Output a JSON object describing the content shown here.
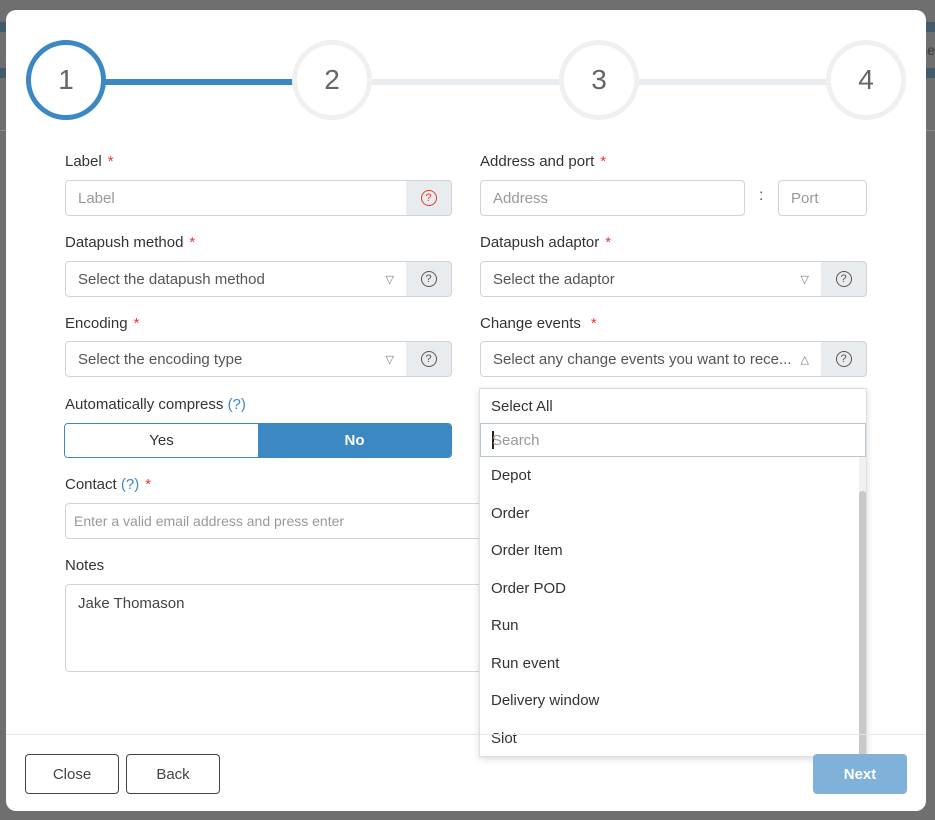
{
  "backdrop": {
    "partial_text": "Se"
  },
  "stepper": {
    "steps": [
      {
        "number": "1",
        "state": "active"
      },
      {
        "number": "2",
        "state": "pending"
      },
      {
        "number": "3",
        "state": "pending"
      },
      {
        "number": "4",
        "state": "pending"
      }
    ],
    "accent_color": "#3c88c2"
  },
  "form": {
    "label": {
      "label": "Label",
      "required": "*",
      "placeholder": "Label"
    },
    "address": {
      "label": "Address and port",
      "required": "*",
      "address_placeholder": "Address",
      "separator": ":",
      "port_placeholder": "Port"
    },
    "datapush_method": {
      "label": "Datapush method",
      "required": "*",
      "placeholder": "Select the datapush method"
    },
    "datapush_adaptor": {
      "label": "Datapush adaptor",
      "required": "*",
      "placeholder": "Select the adaptor"
    },
    "encoding": {
      "label": "Encoding",
      "required": "*",
      "placeholder": "Select the encoding type"
    },
    "change_events": {
      "label": "Change events",
      "required": "*",
      "placeholder": "Select any change events you want to rece..."
    },
    "compress": {
      "label": "Automatically compress",
      "help": "(?)",
      "options": [
        "Yes",
        "No"
      ],
      "selected": "No"
    },
    "contact": {
      "label": "Contact",
      "help": "(?)",
      "required": "*",
      "placeholder": "Enter a valid email address and press enter"
    },
    "notes": {
      "label": "Notes",
      "value": "Jake Thomason"
    }
  },
  "icons": {
    "help": "?",
    "caret_down": "▽",
    "caret_up": "△"
  },
  "dropdown": {
    "select_all": "Select All",
    "search_placeholder": "Search",
    "items": [
      "Depot",
      "Order",
      "Order Item",
      "Order POD",
      "Run",
      "Run event",
      "Delivery window",
      "Slot"
    ]
  },
  "footer": {
    "close": "Close",
    "back": "Back",
    "next": "Next"
  }
}
